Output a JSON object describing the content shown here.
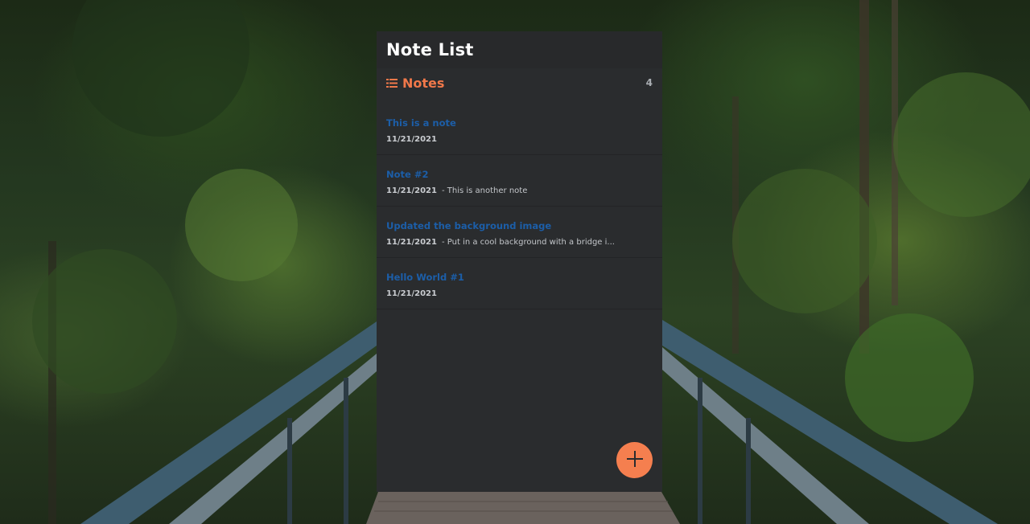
{
  "app": {
    "title": "Note List"
  },
  "section": {
    "label": "Notes",
    "icon": "list-icon",
    "count": "4",
    "accent_color": "#f0784a"
  },
  "notes": [
    {
      "title": "This is a note",
      "date": "11/21/2021",
      "preview": ""
    },
    {
      "title": "Note #2",
      "date": "11/21/2021",
      "preview": "- This is another note"
    },
    {
      "title": "Updated the background image",
      "date": "11/21/2021",
      "preview": "- Put in a cool background with a bridge i..."
    },
    {
      "title": "Hello World #1",
      "date": "11/21/2021",
      "preview": ""
    }
  ],
  "fab": {
    "icon": "plus-icon",
    "color": "#f57f4f"
  },
  "colors": {
    "panel": "#2a2c2e",
    "note_title": "#1c5ea8",
    "background": "forest-bridge"
  }
}
